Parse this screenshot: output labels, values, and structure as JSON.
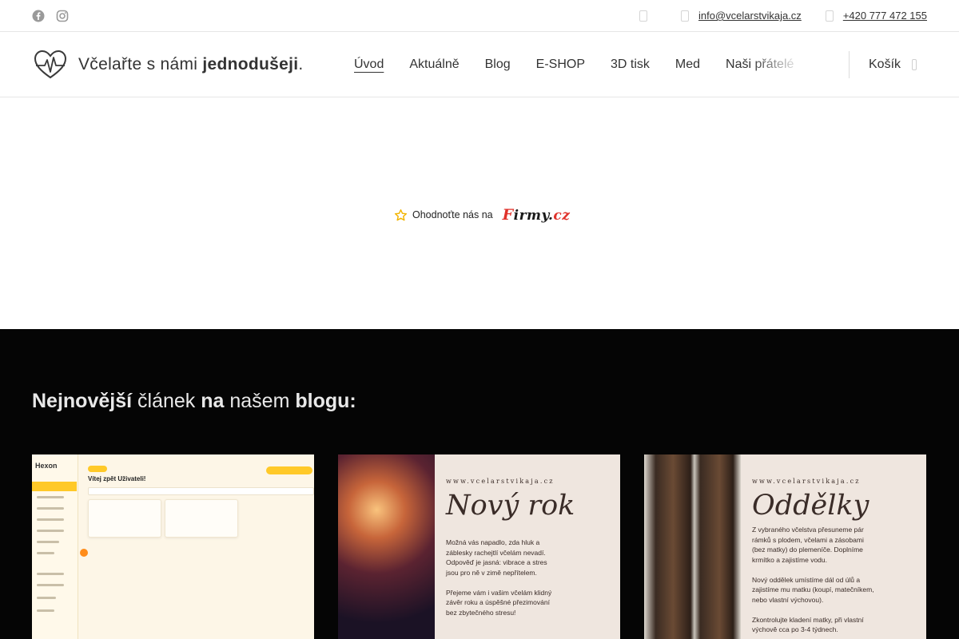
{
  "topbar": {
    "social_icons": [
      "facebook-icon",
      "instagram-icon"
    ],
    "email": "info@vcelarstvikaja.cz",
    "phone": "+420 777 472 155"
  },
  "header": {
    "brand": {
      "part1": "Včelařte s námi ",
      "part2": "jednodušeji",
      "part3": "."
    },
    "nav": [
      "Úvod",
      "Aktuálně",
      "Blog",
      "E-SHOP",
      "3D tisk",
      "Med",
      "Naši přátelé"
    ],
    "active_nav": "Úvod",
    "cart_label": "Košík"
  },
  "badge": {
    "text": "Ohodnoťte nás na",
    "logo": {
      "f": "F",
      "rest": "irmy.",
      "cz": "cz"
    }
  },
  "blog": {
    "heading": {
      "w1": "Nejnovější",
      "w2": " článek ",
      "w3": "na",
      "w4": " našem ",
      "w5": "blogu:"
    },
    "cards": [
      {
        "app_name": "Hexon",
        "greeting": "Vítej zpět Uživateli!"
      },
      {
        "url": "www.vcelarstvikaja.cz",
        "title": "Nový rok",
        "body": "Možná vás napadlo, zda hluk a\nzáblesky rachejtlí včelám nevadí.\nOdpověď je jasná: vibrace a stres\njsou pro ně v zimě nepřítelem.\n\nPřejeme vám i vašim včelám klidný\nzávěr roku a úspěšné přezimování\nbez zbytečného stresu!"
      },
      {
        "url": "www.vcelarstvikaja.cz",
        "title": "Oddělky",
        "body": "Z vybraného včelstva přesuneme pár\nrámků s plodem, včelami a zásobami\n(bez matky) do plemeníče. Doplníme\nkrmítko a zajistíme vodu.\n\nNový oddělek umístíme dál od úlů a\nzajistíme mu matku (koupí, matečníkem,\nnebo vlastní výchovou).\n\nZkontrolujte kladení matky, při vlastní\nvýchově cca po 3-4 týdnech."
      }
    ]
  },
  "colors": {
    "dark_bg": "#050505",
    "accent_yellow": "#ffc928",
    "firmy_red": "#e0322b"
  }
}
